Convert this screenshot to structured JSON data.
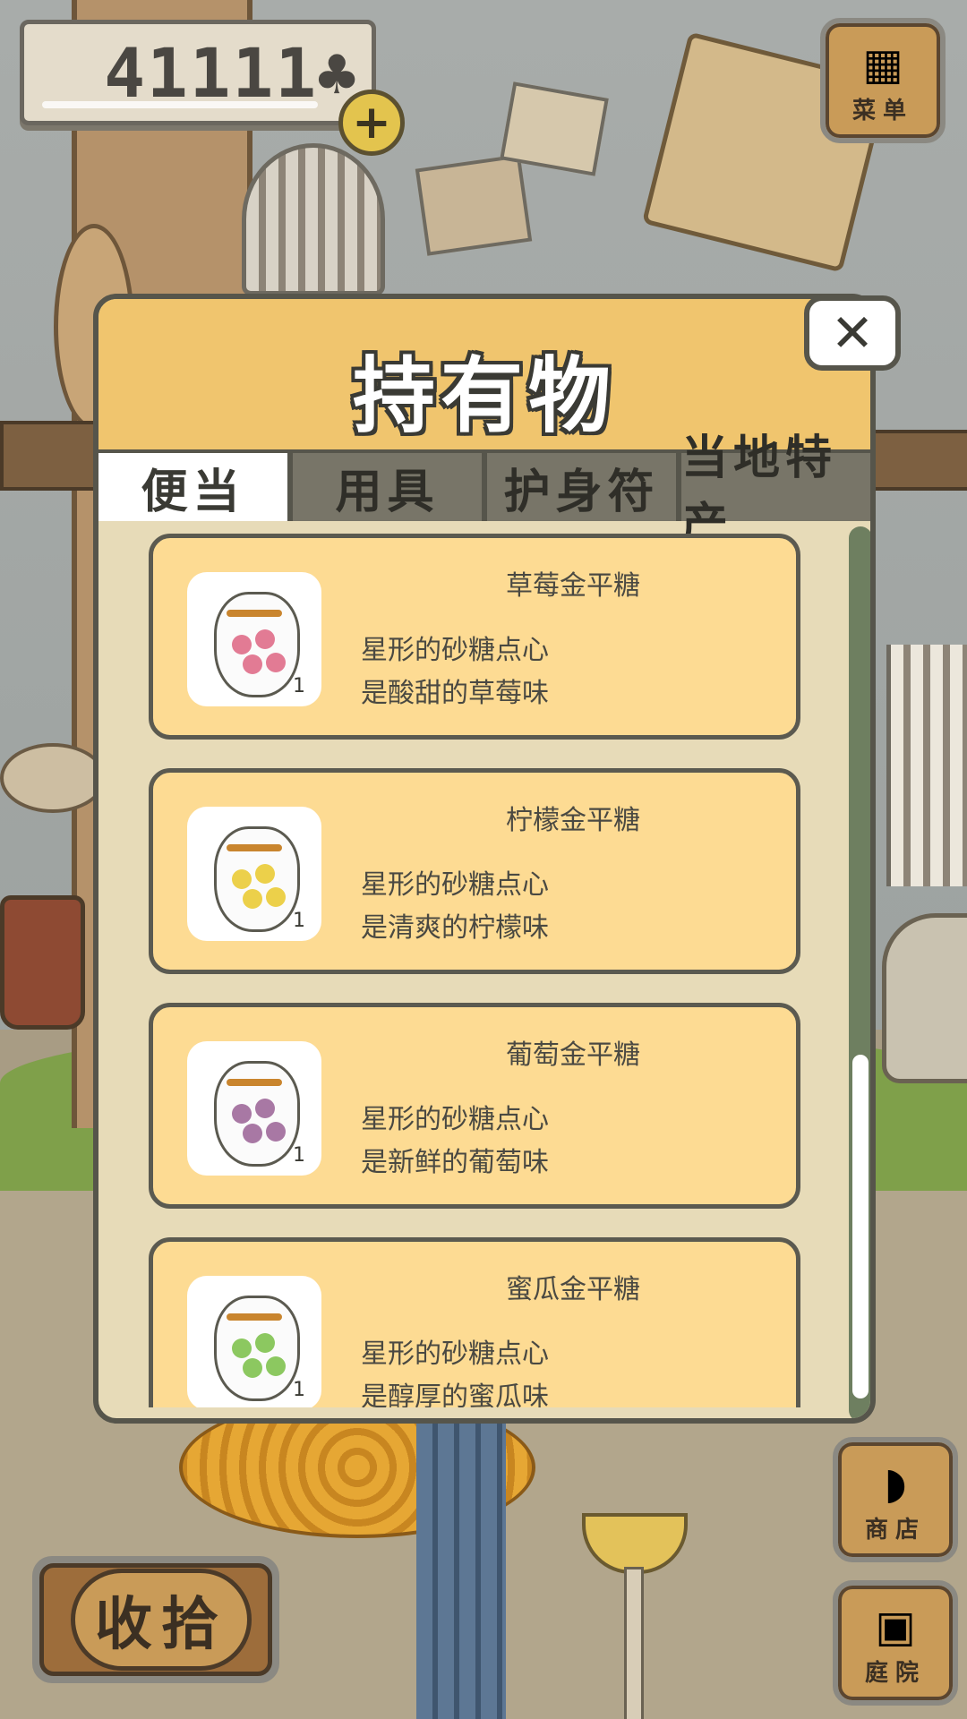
{
  "currency": {
    "value": "41111",
    "icon": "clover-icon",
    "add_label": "+"
  },
  "menu_button": {
    "label": "菜单",
    "icon": "menu-cards-icon"
  },
  "shop_button": {
    "label": "商店",
    "icon": "shop-bag-icon"
  },
  "yard_button": {
    "label": "庭院",
    "icon": "mailbox-icon"
  },
  "collect_button": {
    "label": "收拾"
  },
  "dialog": {
    "title": "持有物",
    "close_label": "✕",
    "tabs": [
      {
        "label": "便当",
        "active": true
      },
      {
        "label": "用具",
        "active": false
      },
      {
        "label": "护身符",
        "active": false
      },
      {
        "label": "当地特产",
        "active": false
      }
    ],
    "items": [
      {
        "name": "草莓金平糖",
        "desc1": "星形的砂糖点心",
        "desc2": "是酸甜的草莓味",
        "count": "1",
        "color": "#e27b94"
      },
      {
        "name": "柠檬金平糖",
        "desc1": "星形的砂糖点心",
        "desc2": "是清爽的柠檬味",
        "count": "1",
        "color": "#ecd04a"
      },
      {
        "name": "葡萄金平糖",
        "desc1": "星形的砂糖点心",
        "desc2": "是新鲜的葡萄味",
        "count": "1",
        "color": "#a878a4"
      },
      {
        "name": "蜜瓜金平糖",
        "desc1": "星形的砂糖点心",
        "desc2": "是醇厚的蜜瓜味",
        "count": "1",
        "color": "#8cc860"
      }
    ],
    "scroll_position": 0.6
  },
  "colors": {
    "header": "#f0c56e",
    "card": "#fddb93",
    "panel": "#e7dbb8",
    "outline": "#56554b"
  }
}
